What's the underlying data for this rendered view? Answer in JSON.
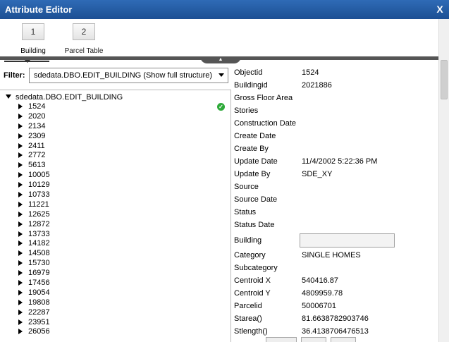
{
  "window": {
    "title": "Attribute Editor",
    "close_label": "X"
  },
  "tabs": [
    {
      "num": "1",
      "label": "Building"
    },
    {
      "num": "2",
      "label": "Parcel Table"
    }
  ],
  "divider": {
    "handle_glyph": "▲"
  },
  "filter": {
    "label": "Filter:",
    "selected": "sdedata.DBO.EDIT_BUILDING (Show  full structure)"
  },
  "tree": {
    "root": "sdedata.DBO.EDIT_BUILDING",
    "items": [
      "1524",
      "2020",
      "2134",
      "2309",
      "2411",
      "2772",
      "5613",
      "10005",
      "10129",
      "10733",
      "11221",
      "12625",
      "12872",
      "13733",
      "14182",
      "14508",
      "15730",
      "16979",
      "17456",
      "19054",
      "19808",
      "22287",
      "23951",
      "26056"
    ],
    "valid_glyph": "✓"
  },
  "attributes": [
    {
      "key": "Objectid",
      "value": "1524"
    },
    {
      "key": "Buildingid",
      "value": "2021886"
    },
    {
      "key": "Gross Floor Area",
      "value": ""
    },
    {
      "key": "Stories",
      "value": ""
    },
    {
      "key": "Construction Date",
      "value": ""
    },
    {
      "key": "Create Date",
      "value": ""
    },
    {
      "key": "Create By",
      "value": ""
    },
    {
      "key": "Update Date",
      "value": "11/4/2002 5:22:36 PM"
    },
    {
      "key": "Update By",
      "value": "SDE_XY"
    },
    {
      "key": "Source",
      "value": ""
    },
    {
      "key": "Source Date",
      "value": ""
    },
    {
      "key": "Status",
      "value": ""
    },
    {
      "key": "Status Date",
      "value": ""
    },
    {
      "key": "Building",
      "value": ""
    },
    {
      "key": "Category",
      "value": "SINGLE HOMES"
    },
    {
      "key": "Subcategory",
      "value": ""
    },
    {
      "key": "Centroid X",
      "value": "540416.87"
    },
    {
      "key": "Centroid Y",
      "value": "4809959.78"
    },
    {
      "key": "Parcelid",
      "value": "50006701"
    },
    {
      "key": "Starea()",
      "value": "81.6638782903746"
    },
    {
      "key": "Stlength()",
      "value": "36.4138706476513"
    }
  ],
  "colors": {
    "titlebar": "#1c4f93",
    "divider": "#555555",
    "valid": "#2eaa3a"
  }
}
